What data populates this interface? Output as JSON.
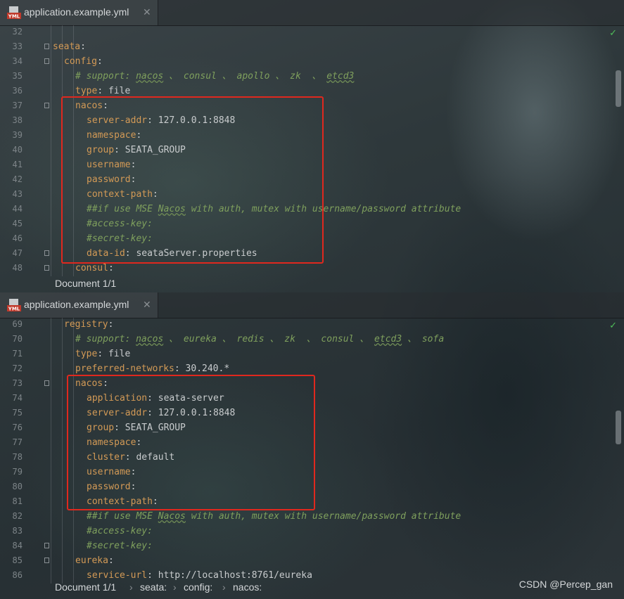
{
  "pane1": {
    "tab": {
      "title": "application.example.yml",
      "icon": "yml-file-icon",
      "close": "✕"
    },
    "lines": [
      {
        "n": "32",
        "indent": 0,
        "key": "",
        "val": "",
        "cmt": ""
      },
      {
        "n": "33",
        "indent": 0,
        "key": "seata",
        "val": ":",
        "cmt": ""
      },
      {
        "n": "34",
        "indent": 1,
        "key": "config",
        "val": ":",
        "cmt": ""
      },
      {
        "n": "35",
        "indent": 2,
        "key": "",
        "val": "",
        "cmt": "# support: nacos 、 consul 、 apollo 、 zk  、 etcd3"
      },
      {
        "n": "36",
        "indent": 2,
        "key": "type",
        "val": ": file",
        "cmt": ""
      },
      {
        "n": "37",
        "indent": 2,
        "key": "nacos",
        "val": ":",
        "cmt": ""
      },
      {
        "n": "38",
        "indent": 3,
        "key": "server-addr",
        "val": ": 127.0.0.1:8848",
        "cmt": ""
      },
      {
        "n": "39",
        "indent": 3,
        "key": "namespace",
        "val": ":",
        "cmt": ""
      },
      {
        "n": "40",
        "indent": 3,
        "key": "group",
        "val": ": SEATA_GROUP",
        "cmt": ""
      },
      {
        "n": "41",
        "indent": 3,
        "key": "username",
        "val": ":",
        "cmt": ""
      },
      {
        "n": "42",
        "indent": 3,
        "key": "password",
        "val": ":",
        "cmt": ""
      },
      {
        "n": "43",
        "indent": 3,
        "key": "context-path",
        "val": ":",
        "cmt": ""
      },
      {
        "n": "44",
        "indent": 3,
        "key": "",
        "val": "",
        "cmt": "##if use MSE Nacos with auth, mutex with username/password attribute"
      },
      {
        "n": "45",
        "indent": 3,
        "key": "",
        "val": "",
        "cmt": "#access-key:"
      },
      {
        "n": "46",
        "indent": 3,
        "key": "",
        "val": "",
        "cmt": "#secret-key:"
      },
      {
        "n": "47",
        "indent": 3,
        "key": "data-id",
        "val": ": seataServer.properties",
        "cmt": ""
      },
      {
        "n": "48",
        "indent": 2,
        "key": "consul",
        "val": ":",
        "cmt": ""
      }
    ],
    "status": "Document 1/1"
  },
  "pane2": {
    "tab": {
      "title": "application.example.yml",
      "icon": "yml-file-icon",
      "close": "✕"
    },
    "lines": [
      {
        "n": "69",
        "indent": 1,
        "key": "registry",
        "val": ":",
        "cmt": ""
      },
      {
        "n": "70",
        "indent": 2,
        "key": "",
        "val": "",
        "cmt": "# support: nacos 、 eureka 、 redis 、 zk  、 consul 、 etcd3 、 sofa"
      },
      {
        "n": "71",
        "indent": 2,
        "key": "type",
        "val": ": file",
        "cmt": ""
      },
      {
        "n": "72",
        "indent": 2,
        "key": "preferred-networks",
        "val": ": 30.240.*",
        "cmt": ""
      },
      {
        "n": "73",
        "indent": 2,
        "key": "nacos",
        "val": ":",
        "cmt": ""
      },
      {
        "n": "74",
        "indent": 3,
        "key": "application",
        "val": ": seata-server",
        "cmt": ""
      },
      {
        "n": "75",
        "indent": 3,
        "key": "server-addr",
        "val": ": 127.0.0.1:8848",
        "cmt": ""
      },
      {
        "n": "76",
        "indent": 3,
        "key": "group",
        "val": ": SEATA_GROUP",
        "cmt": ""
      },
      {
        "n": "77",
        "indent": 3,
        "key": "namespace",
        "val": ":",
        "cmt": ""
      },
      {
        "n": "78",
        "indent": 3,
        "key": "cluster",
        "val": ": default",
        "cmt": ""
      },
      {
        "n": "79",
        "indent": 3,
        "key": "username",
        "val": ":",
        "cmt": ""
      },
      {
        "n": "80",
        "indent": 3,
        "key": "password",
        "val": ":",
        "cmt": ""
      },
      {
        "n": "81",
        "indent": 3,
        "key": "context-path",
        "val": ":",
        "cmt": ""
      },
      {
        "n": "82",
        "indent": 3,
        "key": "",
        "val": "",
        "cmt": "##if use MSE Nacos with auth, mutex with username/password attribute"
      },
      {
        "n": "83",
        "indent": 3,
        "key": "",
        "val": "",
        "cmt": "#access-key:"
      },
      {
        "n": "84",
        "indent": 3,
        "key": "",
        "val": "",
        "cmt": "#secret-key:"
      },
      {
        "n": "85",
        "indent": 2,
        "key": "eureka",
        "val": ":",
        "cmt": ""
      },
      {
        "n": "86",
        "indent": 3,
        "key": "service-url",
        "val": ": http://localhost:8761/eureka",
        "cmt": ""
      }
    ],
    "breadcrumb": {
      "doc": "Document 1/1",
      "items": [
        "seata:",
        "config:",
        "nacos:"
      ]
    }
  },
  "watermark": "CSDN @Percep_gan",
  "colors": {
    "key": "#d39a56",
    "value": "#c9ccce",
    "comment": "#7fa05d",
    "highlight": "#e0281e",
    "ok": "#4fbf5a"
  }
}
